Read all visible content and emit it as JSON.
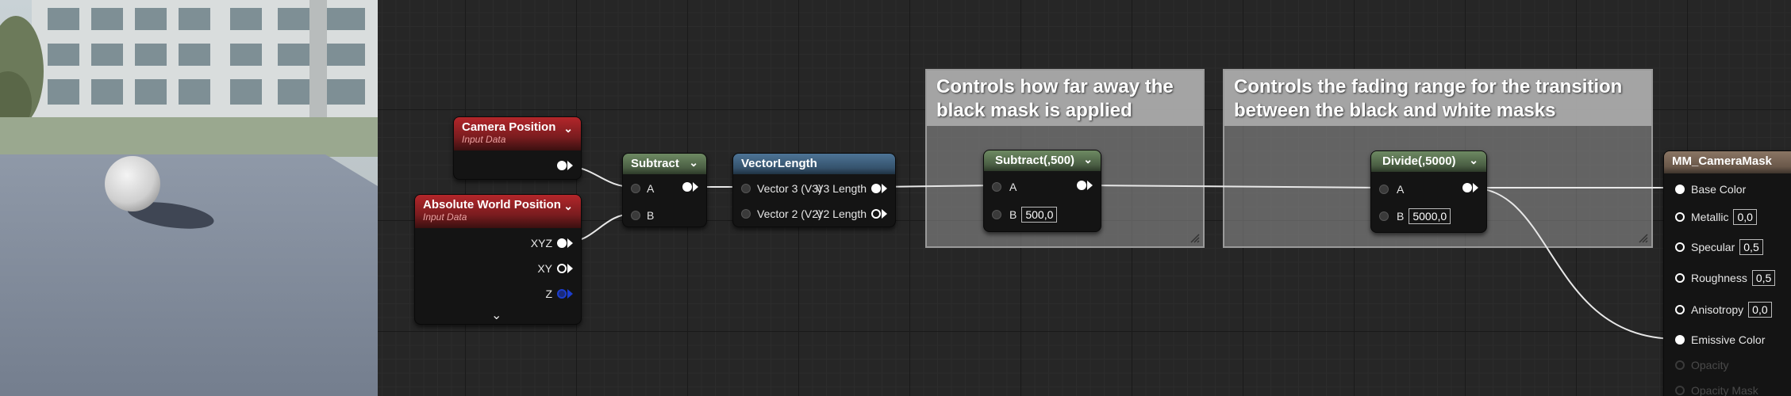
{
  "comments": [
    {
      "title": "Controls how far away the black mask is applied"
    },
    {
      "title": "Controls the fading range for the transition between the black and white masks"
    }
  ],
  "nodes": {
    "camera_position": {
      "title": "Camera Position",
      "subtitle": "Input Data"
    },
    "absolute_world_position": {
      "title": "Absolute World Position",
      "subtitle": "Input Data",
      "outputs": [
        "XYZ",
        "XY",
        "Z"
      ]
    },
    "subtract": {
      "title": "Subtract",
      "inputs": [
        "A",
        "B"
      ]
    },
    "vector_length": {
      "title": "VectorLength",
      "inputs": [
        "Vector 3 (V3)",
        "Vector 2 (V2)"
      ],
      "outputs": [
        "V3 Length",
        "V2 Length"
      ]
    },
    "subtract_500": {
      "title": "Subtract(,500)",
      "inputs": [
        "A",
        "B"
      ],
      "b_value": "500,0"
    },
    "divide_5000": {
      "title": "Divide(,5000)",
      "inputs": [
        "A",
        "B"
      ],
      "b_value": "5000,0"
    },
    "material": {
      "title": "MM_CameraMask",
      "inputs": [
        {
          "label": "Base Color",
          "value": ""
        },
        {
          "label": "Metallic",
          "value": "0,0"
        },
        {
          "label": "Specular",
          "value": "0,5"
        },
        {
          "label": "Roughness",
          "value": "0,5"
        },
        {
          "label": "Anisotropy",
          "value": "0,0"
        },
        {
          "label": "Emissive Color",
          "value": ""
        },
        {
          "label": "Opacity",
          "value": ""
        },
        {
          "label": "Opacity Mask",
          "value": ""
        }
      ]
    }
  },
  "colors": {
    "input_header": "#b3262a",
    "math_header": "#6e8a63",
    "vector_header": "#4d7496",
    "material_header": "#8a7564",
    "comment_bg": "#969696"
  }
}
